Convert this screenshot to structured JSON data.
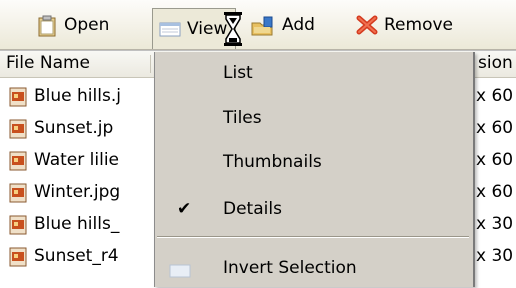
{
  "toolbar": {
    "open_label": "Open",
    "view_label": "View",
    "add_label": "Add",
    "remove_label": "Remove"
  },
  "list": {
    "columns": {
      "name": "File Name",
      "dimensions": "sion"
    },
    "rows": [
      {
        "name": "Blue hills.j",
        "dim": "x 60"
      },
      {
        "name": "Sunset.jp",
        "dim": "x 60"
      },
      {
        "name": "Water lilie",
        "dim": "x 60"
      },
      {
        "name": "Winter.jpg",
        "dim": "x 60"
      },
      {
        "name": "Blue hills_",
        "dim": "x 30"
      },
      {
        "name": "Sunset_r4",
        "dim": "x 30"
      }
    ]
  },
  "view_menu": {
    "items": [
      {
        "label": "List",
        "checked": false
      },
      {
        "label": "Tiles",
        "checked": false
      },
      {
        "label": "Thumbnails",
        "checked": false
      },
      {
        "label": "Details",
        "checked": true
      },
      {
        "label": "Invert Selection",
        "checked": false
      }
    ],
    "check_glyph": "✔"
  },
  "icons": {
    "open": "clipboard-icon",
    "view": "view-list-icon",
    "add": "folder-add-icon",
    "remove": "red-x-icon",
    "file": "image-file-icon",
    "cursor": "hourglass-icon"
  },
  "colors": {
    "remove_x": "#d43a1e",
    "file_icon": "#c8501e",
    "folder": "#3a78c8"
  }
}
